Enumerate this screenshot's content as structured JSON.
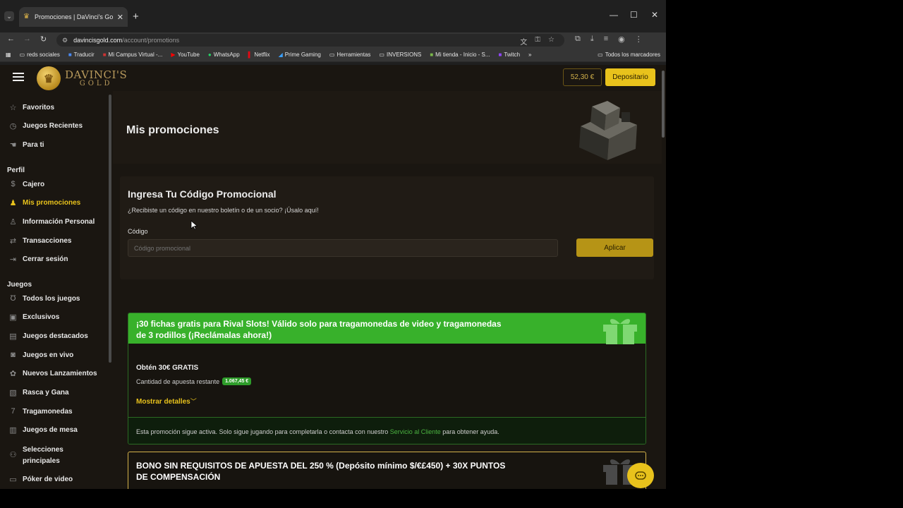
{
  "browser": {
    "tab_title": "Promociones | DaVinci's Gold",
    "url_domain": "davincisgold.com",
    "url_path": "/account/promotions",
    "bookmarks": [
      {
        "label": "reds sociales",
        "icon": "folder-icon"
      },
      {
        "label": "Traducir",
        "icon": "translate-icon"
      },
      {
        "label": "Mi Campus Virtual -...",
        "icon": "campus-icon"
      },
      {
        "label": "YouTube",
        "icon": "youtube-icon"
      },
      {
        "label": "WhatsApp",
        "icon": "whatsapp-icon"
      },
      {
        "label": "Netflix",
        "icon": "netflix-icon"
      },
      {
        "label": "Prime Gaming",
        "icon": "prime-icon"
      },
      {
        "label": "Herramientas",
        "icon": "folder-icon"
      },
      {
        "label": "INVERSIONS",
        "icon": "folder-icon"
      },
      {
        "label": "Mi tienda - Inicio - S...",
        "icon": "shop-icon"
      },
      {
        "label": "Twitch",
        "icon": "twitch-icon"
      }
    ],
    "all_bookmarks": "Todos los marcadores"
  },
  "header": {
    "logo_line1": "DAVINCI'S",
    "logo_line2": "GOLD",
    "balance": "52,30 €",
    "deposit_label": "Depositario"
  },
  "sidebar": {
    "top_items": [
      {
        "label": "Favoritos",
        "icon": "star-icon"
      },
      {
        "label": "Juegos Recientes",
        "icon": "recent-icon"
      },
      {
        "label": "Para ti",
        "icon": "pointer-icon"
      }
    ],
    "profile_heading": "Perfil",
    "profile_items": [
      {
        "label": "Cajero",
        "icon": "dollar-icon"
      },
      {
        "label": "Mis promociones",
        "icon": "bell-icon"
      },
      {
        "label": "Información Personal",
        "icon": "person-icon"
      },
      {
        "label": "Transacciones",
        "icon": "transfer-icon"
      },
      {
        "label": "Cerrar sesión",
        "icon": "logout-icon"
      }
    ],
    "games_heading": "Juegos",
    "games_items": [
      {
        "label": "Todos los juegos",
        "icon": "horseshoe-icon"
      },
      {
        "label": "Exclusivos",
        "icon": "exclusive-icon"
      },
      {
        "label": "Juegos destacados",
        "icon": "featured-icon"
      },
      {
        "label": "Juegos en vivo",
        "icon": "live-icon"
      },
      {
        "label": "Nuevos Lanzamientos",
        "icon": "new-icon"
      },
      {
        "label": "Rasca y Gana",
        "icon": "scratch-icon"
      },
      {
        "label": "Tragamonedas",
        "icon": "slots-icon"
      },
      {
        "label": "Juegos de mesa",
        "icon": "table-games-icon"
      },
      {
        "label": "Selecciones principales",
        "icon": "picks-icon"
      },
      {
        "label": "Póker de video",
        "icon": "poker-icon"
      }
    ]
  },
  "main": {
    "title": "Mis promociones",
    "promo_form": {
      "title": "Ingresa Tu Código Promocional",
      "subtitle": "¿Recibiste un código en nuestro boletín o de un socio? ¡Úsalo aquí!",
      "code_label": "Código",
      "code_placeholder": "Código promocional",
      "apply_label": "Aplicar"
    },
    "promotions": [
      {
        "title": "¡30 fichas gratis para Rival Slots! Válido solo para tragamonedas de video y tragamonedas de 3 rodillos (¡Reclámalas ahora!)",
        "obtain": "Obtén 30€ GRATIS",
        "remaining_label": "Cantidad de apuesta restante",
        "remaining_value": "1.067,45 €",
        "details_label": "Mostrar detalles",
        "footer_pre": "Esta promoción sigue activa. Solo sigue jugando para completarla o contacta con nuestro ",
        "footer_link": "Servicio al Cliente",
        "footer_post": " para obtener ayuda."
      },
      {
        "title": "BONO SIN REQUISITOS DE APUESTA DEL 250 % (Depósito mínimo $/€£450) + 30X PUNTOS DE COMPENSACIÓN"
      }
    ]
  },
  "colors": {
    "accent_gold": "#e8c21c",
    "promo_green": "#38b12b",
    "page_bg": "#1a1611"
  }
}
